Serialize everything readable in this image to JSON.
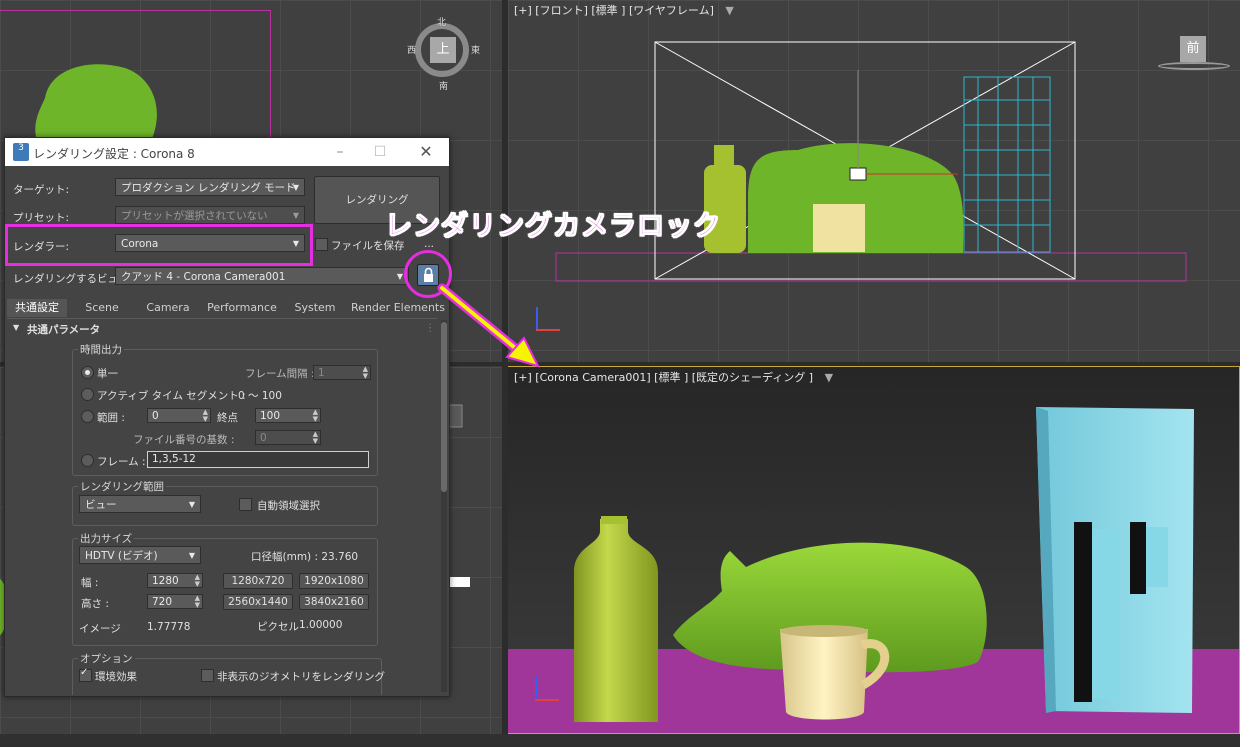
{
  "viewports": {
    "front_label": "[+] [フロント] [標準 ] [ワイヤフレーム]",
    "camera_label": "[+] [Corona Camera001] [標準 ] [既定のシェーディング ]",
    "top_cube": "上",
    "front_cube": "前",
    "compass": {
      "n": "北",
      "s": "南",
      "e": "東",
      "w": "西"
    }
  },
  "dialog": {
    "title": "レンダリング設定 : Corona 8",
    "app_icon": "3",
    "target_label": "ターゲット:",
    "target_value": "プロダクション レンダリング モード",
    "preset_label": "プリセット:",
    "preset_value": "プリセットが選択されていない",
    "renderer_label": "レンダラー:",
    "renderer_value": "Corona",
    "render_button": "レンダリング",
    "save_file_label": "ファイルを保存",
    "ellipsis": "...",
    "view_label": "レンダリングするビュー:",
    "view_value": "クアッド 4 - Corona Camera001",
    "tabs": [
      "共通設定",
      "Scene",
      "Camera",
      "Performance",
      "System",
      "Render Elements"
    ],
    "rollout_title": "共通パラメータ",
    "time_output": {
      "title": "時間出力",
      "single": "単一",
      "frame_interval_label": "フレーム間隔 :",
      "frame_interval": "1",
      "active_segment": "アクティブ タイム セグメント :",
      "active_range": "0 〜 100",
      "range_label": "範囲 :",
      "range_from": "0",
      "end_label": "終点",
      "range_to": "100",
      "file_number_label": "ファイル番号の基数 :",
      "file_number": "0",
      "frames_label": "フレーム :",
      "frames_value": "1,3,5-12"
    },
    "render_area": {
      "title": "レンダリング範囲",
      "value": "ビュー",
      "auto_region": "自動領域選択"
    },
    "output_size": {
      "title": "出力サイズ",
      "preset": "HDTV (ビデオ)",
      "aperture": "口径幅(mm) : 23.760",
      "width_label": "幅 :",
      "width": "1280",
      "height_label": "高さ :",
      "height": "720",
      "presets": [
        "1280x720",
        "1920x1080",
        "2560x1440",
        "3840x2160"
      ],
      "image_label": "イメージ",
      "image_aspect": "1.77778",
      "pixel_label": "ピクセル",
      "pixel_aspect": "1.00000"
    },
    "options": {
      "title": "オプション",
      "atmosphere": "環境効果",
      "render_hidden": "非表示のジオメトリをレンダリング"
    }
  },
  "annotation": {
    "callout_text": "レンダリングカメラロック"
  },
  "colors": {
    "magenta": "#e52ee0",
    "yellow": "#f6f400",
    "bottle": "#a6c12f",
    "cat": "#6fb52a",
    "mug": "#f0e2a0",
    "box": "#86d8e6",
    "floor": "#a0359a"
  }
}
